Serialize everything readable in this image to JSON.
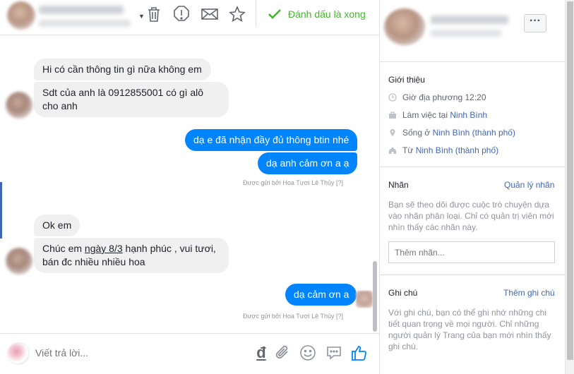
{
  "header": {
    "done_label": "Đánh dấu là xong",
    "icons": [
      "trash-icon",
      "alert-icon",
      "envelope-icon",
      "star-icon",
      "check-icon"
    ]
  },
  "messages": [
    {
      "dir": "in",
      "text": "Hi có cần thông tin gì nữa không em"
    },
    {
      "dir": "in",
      "text_line1": "Sdt của anh là 0912855001 có gì alô",
      "text_line2": "cho anh"
    },
    {
      "dir": "out",
      "text": "dạ e đã nhận đầy đủ thông btin nhé"
    },
    {
      "dir": "out",
      "text": "dạ anh cảm ơn a ạ"
    },
    {
      "dir": "in",
      "text": "Ok em"
    },
    {
      "dir": "in",
      "text_line1_pre": "Chúc em ",
      "text_line1_u": "ngày 8/3",
      "text_line1_post": " hạnh phúc , vui tươi,",
      "text_line2": "bán đc nhiều nhiều hoa"
    },
    {
      "dir": "out",
      "text": "dạ cảm ơn a"
    }
  ],
  "sent_by": {
    "label": "Được gửi bởi Hoa Tươi Lê Thủy",
    "help": "[?]"
  },
  "composer": {
    "placeholder": "Viết trả lời...",
    "dong_symbol": "đ",
    "icons": [
      "dong-icon",
      "attachment-icon",
      "emoji-icon",
      "saved-replies-icon",
      "like-icon"
    ]
  },
  "profile": {
    "intro_title": "Giới thiệu",
    "local_time": "Giờ địa phương 12:20",
    "work_prefix": "Làm việc tại ",
    "work_place": "Ninh Bình",
    "lives_prefix": "Sống ở ",
    "lives_place": "Ninh Bình (thành phố)",
    "from_prefix": "Từ ",
    "from_place": "Ninh Bình (thành phố)",
    "more_label": "···"
  },
  "labels": {
    "title": "Nhãn",
    "manage": "Quản lý nhãn",
    "desc": "Bạn sẽ theo dõi được cuộc trò chuyện dựa vào nhãn phân loại. Chỉ có quản trị viên mới nhìn thấy các nhãn này.",
    "placeholder": "Thêm nhãn..."
  },
  "notes": {
    "title": "Ghi chú",
    "add": "Thêm ghi chú",
    "desc": "Với ghi chú, bạn có thể ghi nhớ những chi tiết quan trọng về mọi người. Chỉ những người quản lý Trang của bạn mới nhìn thấy ghi chú."
  },
  "colors": {
    "accent": "#0084ff",
    "link": "#4267b2",
    "done": "#42b72a"
  }
}
